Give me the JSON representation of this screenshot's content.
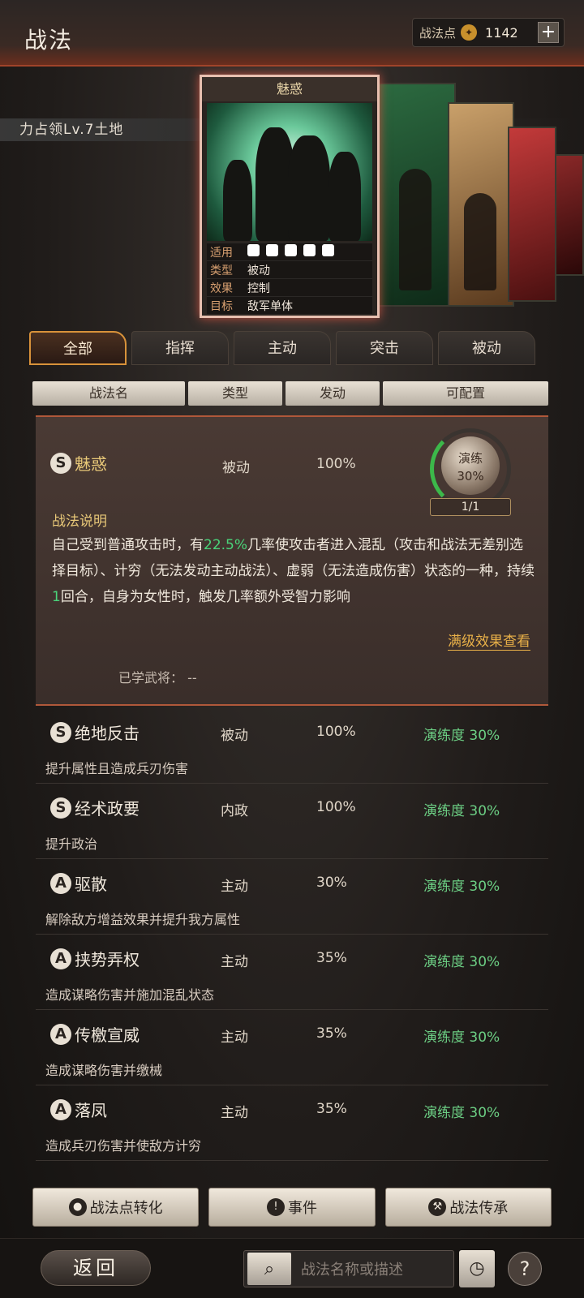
{
  "header": {
    "title": "战法",
    "points_label": "战法点",
    "points_value": "1142",
    "plus": "+"
  },
  "occupy_text": "力占领Lv.7土地",
  "card": {
    "title": "魅惑",
    "rows": [
      {
        "k": "适用",
        "v": ""
      },
      {
        "k": "类型",
        "v": "被动"
      },
      {
        "k": "效果",
        "v": "控制"
      },
      {
        "k": "目标",
        "v": "敌军单体"
      }
    ]
  },
  "tabs": [
    "全部",
    "指挥",
    "主动",
    "突击",
    "被动"
  ],
  "columns": [
    "战法名",
    "类型",
    "发动",
    "可配置"
  ],
  "expanded": {
    "rank": "S",
    "name": "魅惑",
    "type": "被动",
    "pct": "100%",
    "practice_label": "演练",
    "practice_value": "30%",
    "practice_count": "1/1",
    "desc_title": "战法说明",
    "desc_part1": "自己受到普通攻击时，有",
    "desc_hl1": "22.5%",
    "desc_part2": "几率使攻击者进入混乱（攻击和战法无差别选择目标）、计穷（无法发动主动战法）、虚弱（无法造成伤害）状态的一种，持续",
    "desc_hl2": "1",
    "desc_part3": "回合，自身为女性时，触发几率额外受智力影响",
    "full_view": "满级效果查看",
    "learned_label": "已学武将：",
    "learned_value": "--"
  },
  "items": [
    {
      "rank": "S",
      "name": "绝地反击",
      "type": "被动",
      "pct": "100%",
      "prac": "演练度 30%",
      "sub": "提升属性且造成兵刃伤害"
    },
    {
      "rank": "S",
      "name": "经术政要",
      "type": "内政",
      "pct": "100%",
      "prac": "演练度 30%",
      "sub": "提升政治"
    },
    {
      "rank": "A",
      "name": "驱散",
      "type": "主动",
      "pct": "30%",
      "prac": "演练度 30%",
      "sub": "解除敌方增益效果并提升我方属性"
    },
    {
      "rank": "A",
      "name": "挟势弄权",
      "type": "主动",
      "pct": "35%",
      "prac": "演练度 30%",
      "sub": "造成谋略伤害并施加混乱状态"
    },
    {
      "rank": "A",
      "name": "传檄宣威",
      "type": "主动",
      "pct": "35%",
      "prac": "演练度 30%",
      "sub": "造成谋略伤害并缴械"
    },
    {
      "rank": "A",
      "name": "落凤",
      "type": "主动",
      "pct": "35%",
      "prac": "演练度 30%",
      "sub": "造成兵刃伤害并使敌方计穷"
    }
  ],
  "actions": {
    "convert": "战法点转化",
    "event": "事件",
    "inherit": "战法传承"
  },
  "footer": {
    "back": "返回",
    "search_placeholder": "战法名称或描述",
    "help": "?"
  }
}
